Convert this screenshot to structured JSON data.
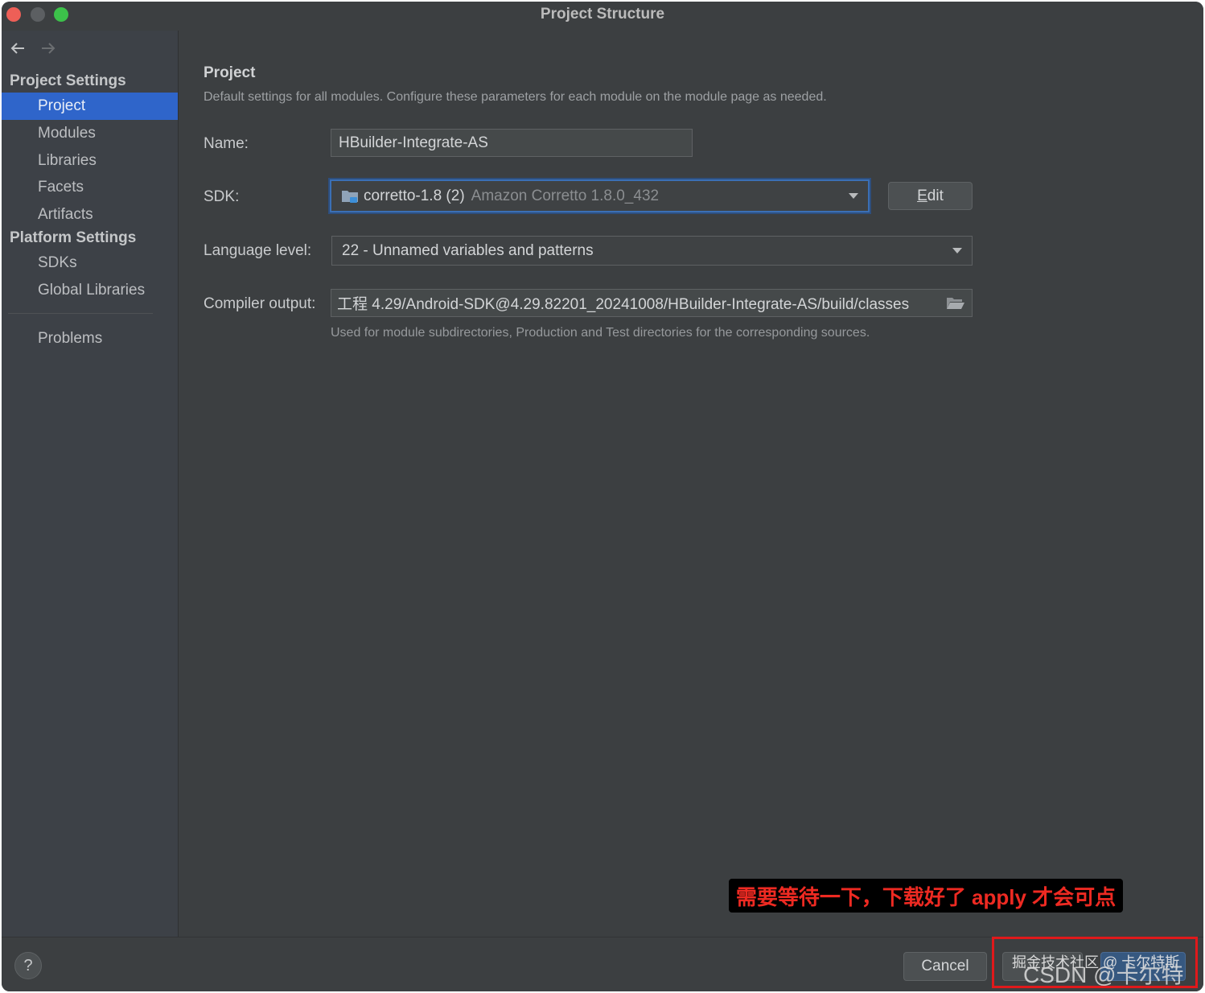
{
  "window": {
    "title": "Project Structure"
  },
  "sidebar": {
    "sections": [
      {
        "title": "Project Settings",
        "items": [
          {
            "label": "Project",
            "selected": true
          },
          {
            "label": "Modules"
          },
          {
            "label": "Libraries"
          },
          {
            "label": "Facets"
          },
          {
            "label": "Artifacts"
          }
        ]
      },
      {
        "title": "Platform Settings",
        "items": [
          {
            "label": "SDKs"
          },
          {
            "label": "Global Libraries"
          }
        ]
      }
    ],
    "problems": "Problems"
  },
  "content": {
    "title": "Project",
    "description": "Default settings for all modules. Configure these parameters for each module on the module page as needed.",
    "name": {
      "label": "Name:",
      "value": "HBuilder-Integrate-AS"
    },
    "sdk": {
      "label": "SDK:",
      "value": "corretto-1.8 (2)",
      "detail": "Amazon Corretto 1.8.0_432",
      "edit_label_mn": "E",
      "edit_label_rest": "dit"
    },
    "language_level": {
      "label": "Language level:",
      "value": "22 - Unnamed variables and patterns"
    },
    "compiler_output": {
      "label": "Compiler output:",
      "value": "工程 4.29/Android-SDK@4.29.82201_20241008/HBuilder-Integrate-AS/build/classes",
      "hint": "Used for module subdirectories, Production and Test directories for the corresponding sources."
    }
  },
  "footer": {
    "help": "?",
    "cancel": "Cancel",
    "apply": "",
    "ok": ""
  },
  "annotations": {
    "note": "需要等待一下，下载好了 apply 才会可点",
    "watermark_1": "掘金技术社区 @ 卡尔特斯",
    "watermark_2": "CSDN @卡尔特斯"
  },
  "colors": {
    "selection": "#2f65ca",
    "annotation_red": "#e0191b"
  }
}
